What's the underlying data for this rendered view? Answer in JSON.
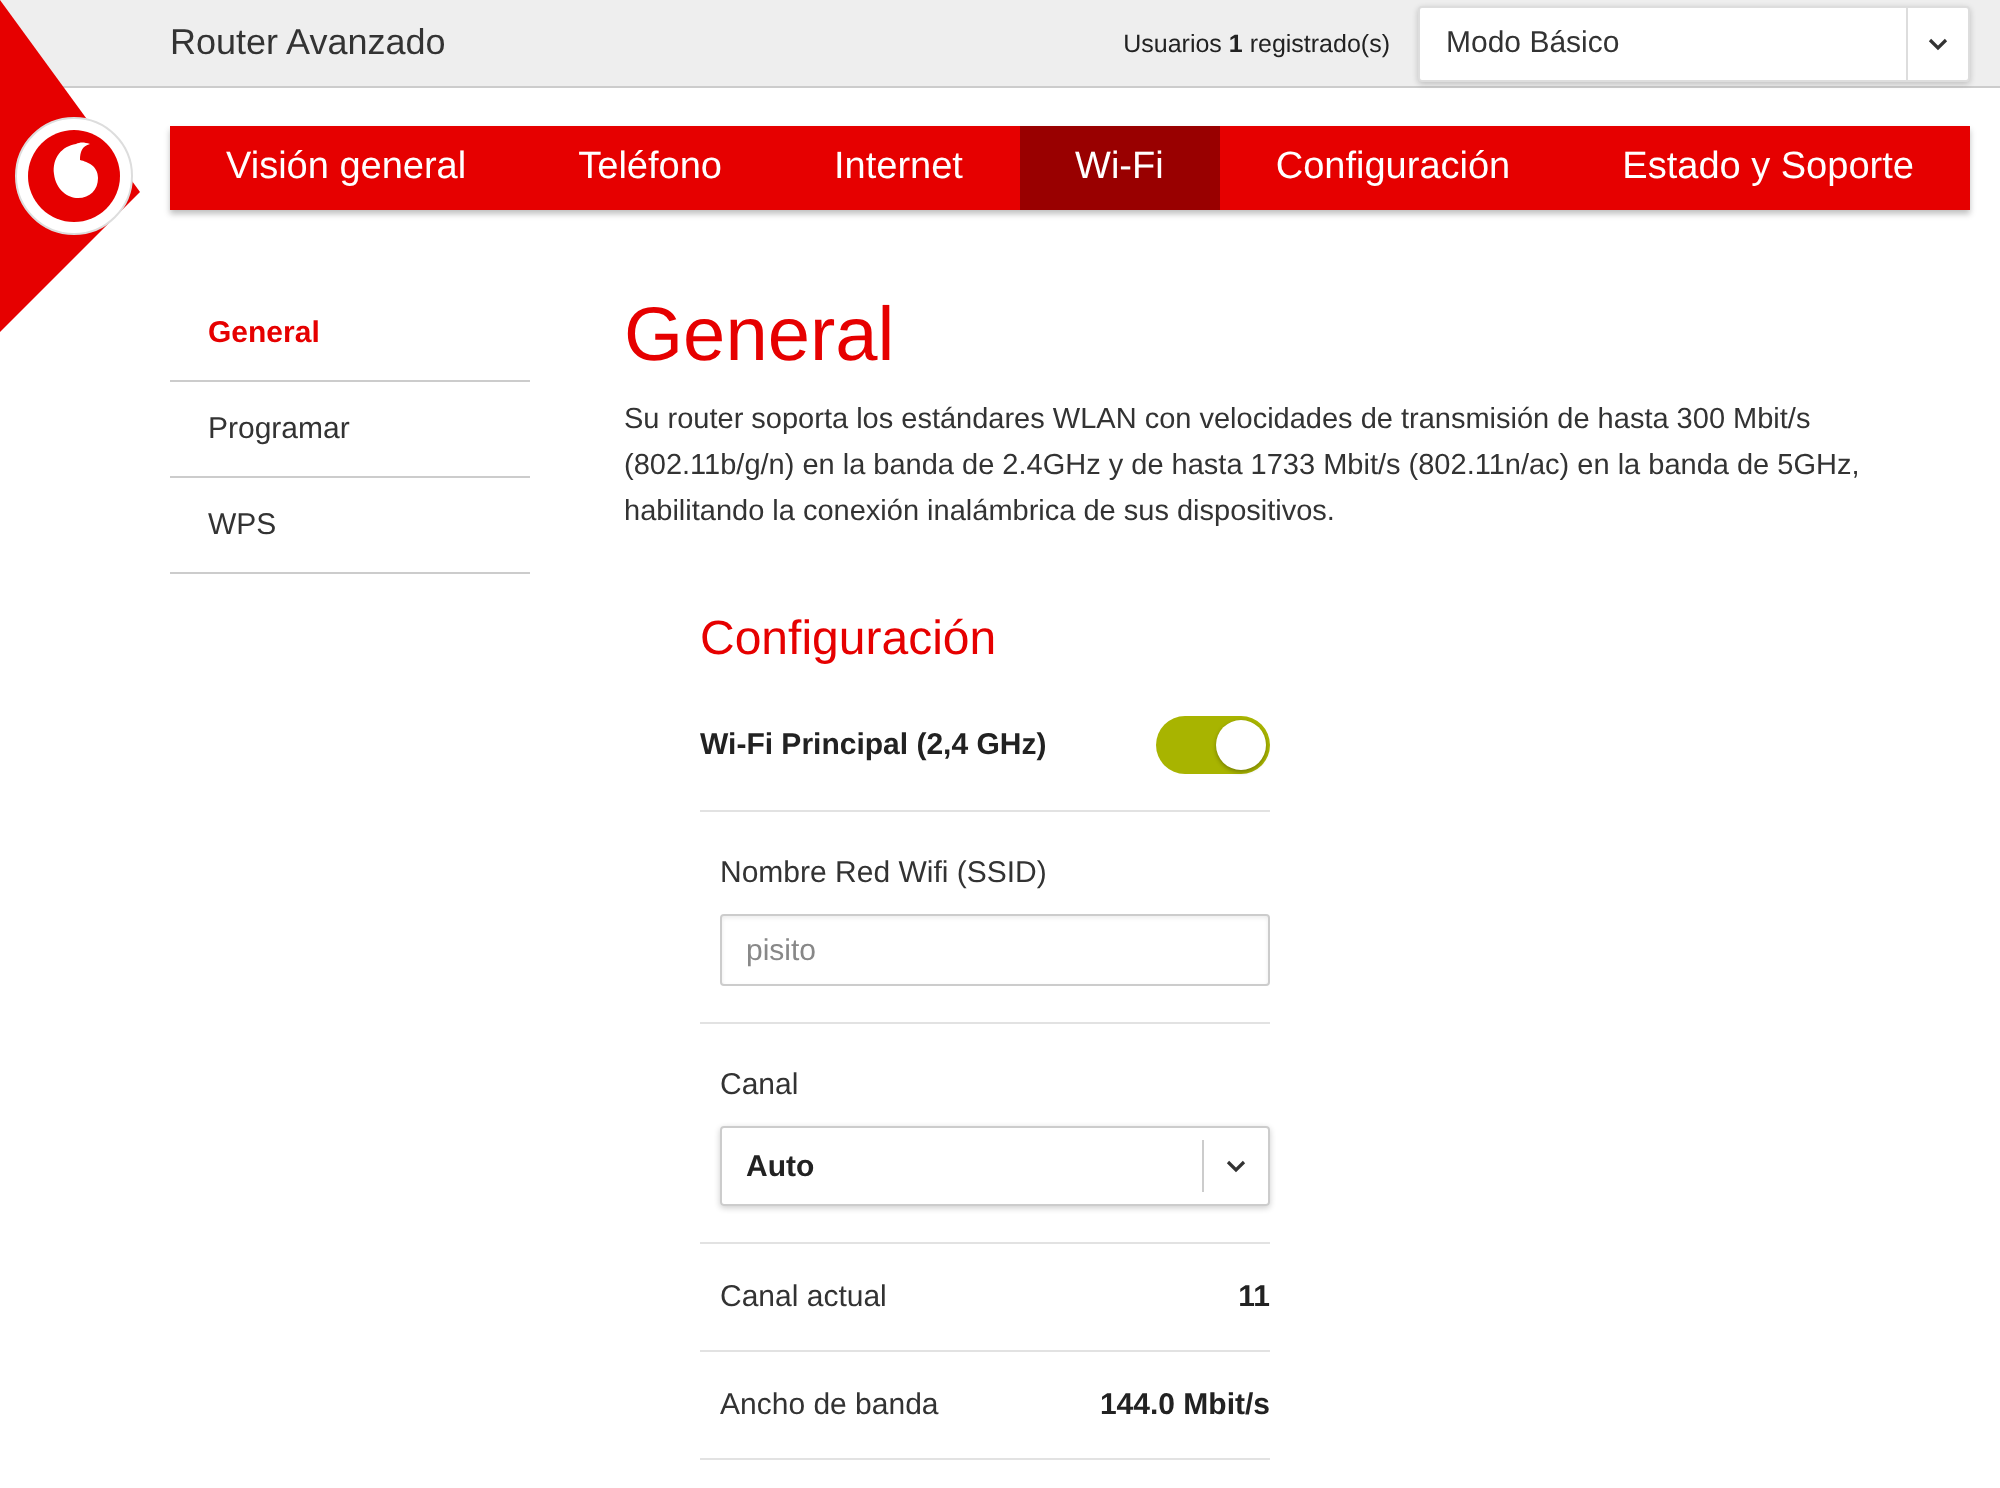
{
  "header": {
    "title": "Router Avanzado",
    "users": "Usuarios **1** registrado(s)",
    "mode_select": {
      "value": "Modo Básico"
    }
  },
  "nav": [
    {
      "label": "Visión general",
      "selected": false
    },
    {
      "label": "Teléfono",
      "selected": false
    },
    {
      "label": "Internet",
      "selected": false
    },
    {
      "label": "Wi-Fi",
      "selected": true
    },
    {
      "label": "Configuración",
      "selected": false
    },
    {
      "label": "Estado y Soporte",
      "selected": false
    }
  ],
  "sidebar": [
    {
      "label": "General",
      "selected": true
    },
    {
      "label": "Programar",
      "selected": false
    },
    {
      "label": "WPS",
      "selected": false
    }
  ],
  "page": {
    "title": "General",
    "description": "Su router soporta los estándares WLAN con velocidades de transmisión de hasta 300 Mbit/s (802.11b/g/n) en la banda de 2.4GHz y de hasta 1733 Mbit/s (802.11n/ac) en la banda de 5GHz, habilitando la conexión inalámbrica de sus dispositivos."
  },
  "config": {
    "title": "Configuración",
    "rows": [
      {
        "kind": "toggle",
        "label": "Wi-Fi Principal (2,4 GHz)",
        "on": true
      },
      {
        "kind": "input",
        "label": "Nombre Red Wifi (SSID)",
        "value": "pisito"
      },
      {
        "kind": "select",
        "label": "Canal",
        "value": "Auto"
      },
      {
        "kind": "info",
        "label": "Canal actual",
        "value": "11"
      },
      {
        "kind": "info",
        "label": "Ancho de banda",
        "value": "144.0 Mbit/s"
      }
    ]
  }
}
